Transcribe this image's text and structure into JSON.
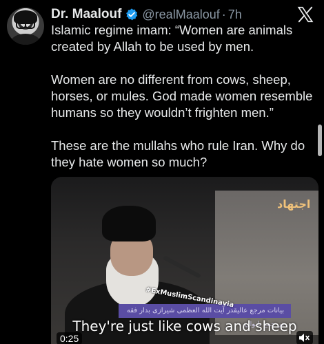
{
  "author": {
    "display_name": "Dr. Maalouf",
    "handle": "@realMaalouf",
    "separator": "·",
    "time": "7h",
    "verified_color": "#1d9bf0",
    "avatar_icon": "profile-photo"
  },
  "app": {
    "close_icon": "x-logo-icon"
  },
  "tweet": {
    "paragraphs": [
      "Islamic regime imam: “Women are animals created by Allah to be used by men.",
      "Women are no different from cows, sheep, horses, or mules. God made women resemble humans so they wouldn’t frighten men.”",
      "These are the mullahs who rule Iran. Why do they hate women so much?"
    ]
  },
  "media": {
    "subtitle": "They're just like cows and sheep",
    "watermark": "#ExMuslimScandinavia",
    "arabic_caption": "بيانات مرجع عاليقدر آيت الله العظمى شيرازى بدار فقه در جمع بانوان",
    "channel_logo": "اجتهاد",
    "duration": "0:25",
    "mute_icon": "muted-speaker-icon"
  },
  "colors": {
    "background": "#000000",
    "text": "#e7e9ea",
    "secondary_text": "#8b98a5"
  }
}
